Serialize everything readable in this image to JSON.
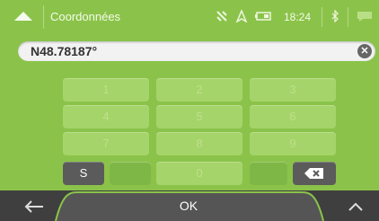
{
  "topbar": {
    "title": "Coordonnées",
    "menu_icon": "caret-up-icon",
    "status": {
      "time": "18:24"
    }
  },
  "input": {
    "value": "N48.78187°",
    "clear_icon": "clear-icon"
  },
  "keypad": {
    "rows": [
      [
        "1",
        "2",
        "3"
      ],
      [
        "4",
        "5",
        "6"
      ],
      [
        "7",
        "8",
        "9"
      ]
    ],
    "s_label": "S",
    "zero_label": "0",
    "backspace_icon": "backspace-icon"
  },
  "bottom": {
    "ok_label": "OK",
    "back_icon": "arrow-left-icon",
    "up_icon": "chevron-up-icon"
  }
}
